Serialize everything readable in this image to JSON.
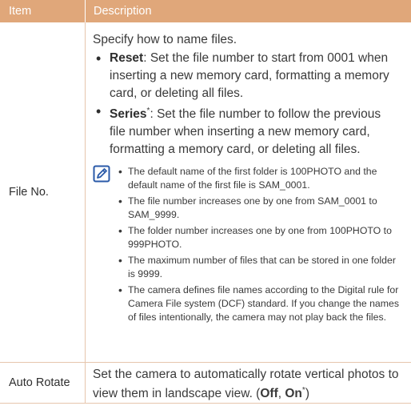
{
  "header": {
    "col1": "Item",
    "col2": "Description"
  },
  "rows": [
    {
      "item": "File No.",
      "intro": "Specify how to name files.",
      "options": [
        {
          "term": "Reset",
          "desc": ": Set the file number to start from 0001 when inserting a new memory card, formatting a memory card, or deleting all files."
        },
        {
          "term": "Series",
          "mark": "*",
          "desc": ": Set the file number to follow the previous file number when inserting a new memory card, formatting a memory card, or deleting all files."
        }
      ],
      "notes": [
        "The default name of the first folder is 100PHOTO and the default name of the first file is SAM_0001.",
        "The file number increases one by one from SAM_0001 to SAM_9999.",
        "The folder number increases one by one from 100PHOTO to 999PHOTO.",
        "The maximum number of files that can be stored in one folder is 9999.",
        "The camera defines file names according to the Digital rule for Camera File system (DCF) standard. If you change the names of files intentionally, the camera may not play back the files."
      ],
      "note_icon": "note-pencil-icon"
    },
    {
      "item": "Auto Rotate",
      "desc_pre": "Set the camera to automatically rotate vertical photos to view them in landscape view. (",
      "off": "Off",
      "sep": ", ",
      "on": "On",
      "mark": "*",
      "desc_post": ")"
    }
  ],
  "colors": {
    "header_bg": "#e0a77a",
    "rule": "#e6c6ad",
    "icon": "#2a5aa8"
  }
}
